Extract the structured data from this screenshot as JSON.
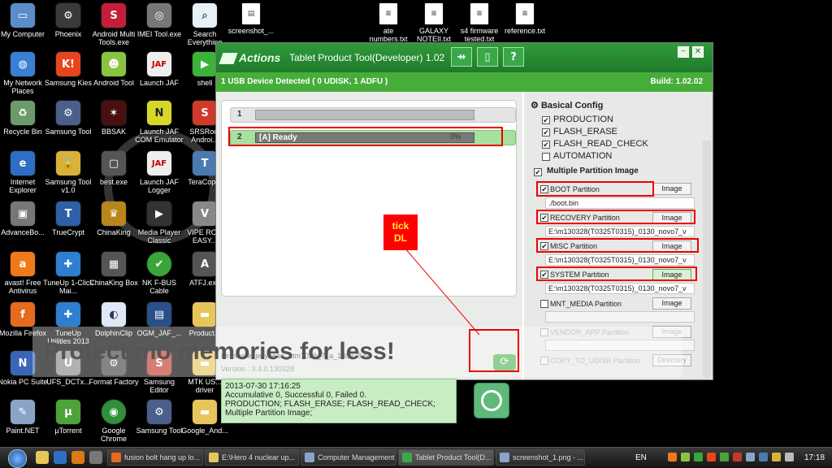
{
  "desktop": {
    "col1": [
      "My Computer",
      "My Network Places",
      "Recycle Bin",
      "Internet Explorer",
      "AdvanceBo...",
      "avast! Free Antivirus",
      "Mozilla Firefox",
      "Nokia PC Suite",
      "Paint.NET"
    ],
    "col2": [
      "Phoenix",
      "Samsung Kies",
      "Samsung Tool",
      "Samsung Tool v1.0",
      "TrueCrypt",
      "TuneUp 1-Click Mai...",
      "TuneUp Utilities 2013",
      "UFS_DCTx...",
      "µTorrent"
    ],
    "col3": [
      "Android Multi Tools.exe",
      "Android Tool",
      "BBSAK",
      "best.exe",
      "ChinaKing",
      "ChinaKing Box",
      "DolphinClip",
      "Format Factory",
      "Google Chrome"
    ],
    "col4": [
      "IMEI Tool.exe",
      "Launch JAF",
      "Launch JAF COM Emulator",
      "Launch JAF Logger",
      "Media Player Classic",
      "NK F-BUS Cable",
      "OGM_JAF_...",
      "Samsung Editor",
      "Samsung Tool"
    ],
    "col5": [
      "Search Everything",
      "shell",
      "SRSRoot Androi...",
      "TeraCop...",
      "VIPE RC... EASY...",
      "ATFJ.exe",
      "Product...",
      "MTK US... driver",
      "Google_And..."
    ],
    "top_files": [
      "screenshot_...",
      "ate numbers.txt",
      "GALAXY NOTEII.txt",
      "s4 firmware tested.txt",
      "reference.txt"
    ]
  },
  "watermark": "Protect mo                                         memories for less!",
  "window": {
    "logo": "Actions",
    "title": "Tablet Product Tool(Developer) 1.02",
    "usb_icon": "usb-icon",
    "status_left": "1 USB Device Detected ( 0 UDISK, 1 ADFU )",
    "build": "Build: 1.02.02",
    "devices": [
      {
        "num": "1",
        "label": "",
        "pct": ""
      },
      {
        "num": "2",
        "label": "[A] Ready",
        "pct": "0%"
      }
    ],
    "firmware": "Firmware: jellybean_atm7029_7_a_130328.fw",
    "version": "Version : 3.4.0.130328",
    "log": [
      "2013-07-30 17:16:25",
      "Accumulative 0, Successful 0, Failed 0.",
      "PRODUCTION; FLASH_ERASE; FLASH_READ_CHECK;",
      "Multiple Partition Image;"
    ],
    "basical_config": "Basical Config",
    "options": [
      "PRODUCTION",
      "FLASH_ERASE",
      "FLASH_READ_CHECK",
      "AUTOMATION"
    ],
    "multi_partition": "Multiple Partition Image",
    "partitions": [
      {
        "name": "BOOT Partition",
        "button": "Image",
        "path": "./boot.bin"
      },
      {
        "name": "RECOVERY Partition",
        "button": "Image",
        "path": "E:\\m130328(T0325T0315)_0130_novo7_v"
      },
      {
        "name": "MISC Partition",
        "button": "Image",
        "path": "E:\\m130328(T0325T0315)_0130_novo7_v"
      },
      {
        "name": "SYSTEM Partition",
        "button": "Image",
        "path": "E:\\m130328(T0325T0315)_0130_novo7_v"
      },
      {
        "name": "MNT_MEDIA Partition",
        "button": "Image",
        "path": ""
      },
      {
        "name": "VENDOR_APP Partition",
        "button": "Image",
        "path": ""
      },
      {
        "name": "COPY_TO_UDISK Partition",
        "button": "Directory",
        "path": ""
      }
    ]
  },
  "annotation": {
    "line1": "tick",
    "line2": "DL"
  },
  "taskbar": {
    "tasks": [
      "fusion bolt hang up lo...",
      "E:\\Hero 4 nuclear up...",
      "Computer Management",
      "Tablet Product Tool(D...",
      "screenshot_1.png - ..."
    ],
    "lang": "EN",
    "clock": "17:18"
  }
}
